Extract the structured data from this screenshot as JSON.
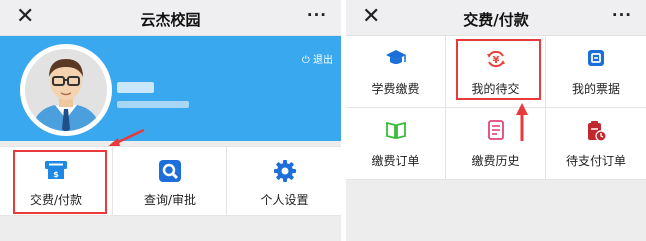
{
  "left_screen": {
    "title": "云杰校园",
    "close_glyph": "✕",
    "more_glyph": "···",
    "logout_label": "退出",
    "grid": [
      {
        "label": "交费/付款",
        "icon": "card-pay-icon",
        "color": "#1e88e5"
      },
      {
        "label": "查询/审批",
        "icon": "search-icon",
        "color": "#1e6fd9"
      },
      {
        "label": "个人设置",
        "icon": "gear-icon",
        "color": "#1e6fd9"
      }
    ]
  },
  "right_screen": {
    "title": "交费/付款",
    "close_glyph": "✕",
    "more_glyph": "···",
    "grid": [
      {
        "label": "学费缴费",
        "icon": "graduation-cap-icon",
        "color": "#1a6fd8"
      },
      {
        "label": "我的待交",
        "icon": "yuan-pending-icon",
        "color": "#e8443a"
      },
      {
        "label": "我的票据",
        "icon": "receipt-icon",
        "color": "#1a6fd8"
      },
      {
        "label": "缴费订单",
        "icon": "book-icon",
        "color": "#3cbc3c"
      },
      {
        "label": "缴费历史",
        "icon": "list-history-icon",
        "color": "#e0457a"
      },
      {
        "label": "待支付订单",
        "icon": "clipboard-clock-icon",
        "color": "#c0282e"
      }
    ]
  },
  "colors": {
    "banner": "#3aa8ee",
    "highlight": "#e83a3a"
  }
}
